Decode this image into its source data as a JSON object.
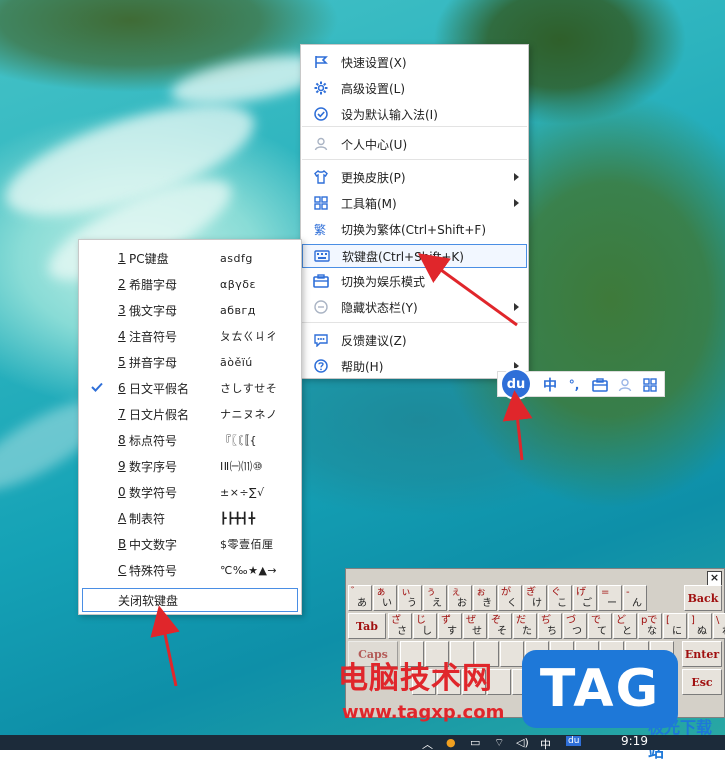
{
  "context_menu": {
    "items": [
      {
        "label": "快速设置(X)",
        "icon": "flag-icon",
        "submenu": false
      },
      {
        "label": "高级设置(L)",
        "icon": "gear-icon",
        "submenu": false
      },
      {
        "label": "设为默认输入法(I)",
        "icon": "check-circle-icon",
        "submenu": false
      },
      {
        "label": "个人中心(U)",
        "icon": "user-icon",
        "submenu": false
      },
      {
        "label": "更换皮肤(P)",
        "icon": "shirt-icon",
        "submenu": true
      },
      {
        "label": "工具箱(M)",
        "icon": "grid-icon",
        "submenu": true
      },
      {
        "label": "切换为繁体(Ctrl+Shift+F)",
        "icon": "traditional-char-icon",
        "submenu": false
      },
      {
        "label": "软键盘(Ctrl+Shift+K)",
        "icon": "keyboard-icon",
        "submenu": false,
        "highlighted": true
      },
      {
        "label": "切换为娱乐模式",
        "icon": "toolbox-icon",
        "submenu": false
      },
      {
        "label": "隐藏状态栏(Y)",
        "icon": "minus-circle-icon",
        "submenu": true
      },
      {
        "label": "反馈建议(Z)",
        "icon": "chat-icon",
        "submenu": false
      },
      {
        "label": "帮助(H)",
        "icon": "help-icon",
        "submenu": true
      }
    ]
  },
  "softkbd_menu": {
    "items": [
      {
        "num": "1",
        "name": "PC键盘",
        "sample": "asdfg",
        "checked": false
      },
      {
        "num": "2",
        "name": "希腊字母",
        "sample": "αβγδε",
        "checked": false
      },
      {
        "num": "3",
        "name": "俄文字母",
        "sample": "абвгд",
        "checked": false
      },
      {
        "num": "4",
        "name": "注音符号",
        "sample": "ㄆㄊㄍㄐㄔ",
        "checked": false
      },
      {
        "num": "5",
        "name": "拼音字母",
        "sample": "āòěïú",
        "checked": false
      },
      {
        "num": "6",
        "name": "日文平假名",
        "sample": "さしすせそ",
        "checked": true
      },
      {
        "num": "7",
        "name": "日文片假名",
        "sample": "ナニヌネノ",
        "checked": false
      },
      {
        "num": "8",
        "name": "标点符号",
        "sample": "『〖〘〚{",
        "checked": false
      },
      {
        "num": "9",
        "name": "数字序号",
        "sample": "ⅠⅡ㈠⑾⑩",
        "checked": false
      },
      {
        "num": "0",
        "name": "数学符号",
        "sample": "±×÷∑√",
        "checked": false
      },
      {
        "num": "A",
        "name": "制表符",
        "sample": "┣┣╋┫╋",
        "checked": false
      },
      {
        "num": "B",
        "name": "中文数字",
        "sample": "$零壹佰厘",
        "checked": false
      },
      {
        "num": "C",
        "name": "特殊符号",
        "sample": "℃‰★▲→",
        "checked": false
      }
    ],
    "close_label": "关闭软键盘"
  },
  "ime_bar": {
    "logo": "du",
    "lang": "中",
    "punct": "°,",
    "icons": [
      "toolbox-icon",
      "user-icon",
      "grid-icon"
    ]
  },
  "soft_keyboard": {
    "close": "×",
    "row1": [
      {
        "up": "゛",
        "dn": "あ"
      },
      {
        "up": "ぁ",
        "dn": "い"
      },
      {
        "up": "ぃ",
        "dn": "う"
      },
      {
        "up": "ぅ",
        "dn": "え"
      },
      {
        "up": "ぇ",
        "dn": "お"
      },
      {
        "up": "ぉ",
        "dn": "き"
      },
      {
        "up": "が",
        "dn": "く"
      },
      {
        "up": "ぎ",
        "dn": "け"
      },
      {
        "up": "ぐ",
        "dn": "こ"
      },
      {
        "up": "げ",
        "dn": "ご"
      },
      {
        "up": "=",
        "dn": "ー"
      },
      {
        "up": "-",
        "dn": "ん"
      }
    ],
    "back_label": "Back",
    "tab_label": "Tab",
    "row2": [
      {
        "up": "ざ",
        "dn": "さ"
      },
      {
        "up": "じ",
        "dn": "し"
      },
      {
        "up": "ず",
        "dn": "す"
      },
      {
        "up": "ぜ",
        "dn": "せ"
      },
      {
        "up": "ぞ",
        "dn": "そ"
      },
      {
        "up": "だ",
        "dn": "た"
      },
      {
        "up": "ぢ",
        "dn": "ち"
      },
      {
        "up": "づ",
        "dn": "つ"
      },
      {
        "up": "で",
        "dn": "て"
      },
      {
        "up": "ど",
        "dn": "と"
      },
      {
        "up": "pで",
        "dn": "な"
      },
      {
        "up": "[",
        "dn": "に"
      },
      {
        "up": "]",
        "dn": "ぬ"
      },
      {
        "up": "\\",
        "dn": "ね"
      }
    ],
    "caps_label": "Caps",
    "enter_label": "Enter",
    "esc_label": "Esc"
  },
  "watermark": {
    "title": "电脑技术网",
    "url": "www.tagxp.com",
    "tag": "TAG",
    "site": "极光下载站"
  },
  "taskbar": {
    "time": "9:19",
    "ime": "中",
    "ime_logo": "du"
  }
}
